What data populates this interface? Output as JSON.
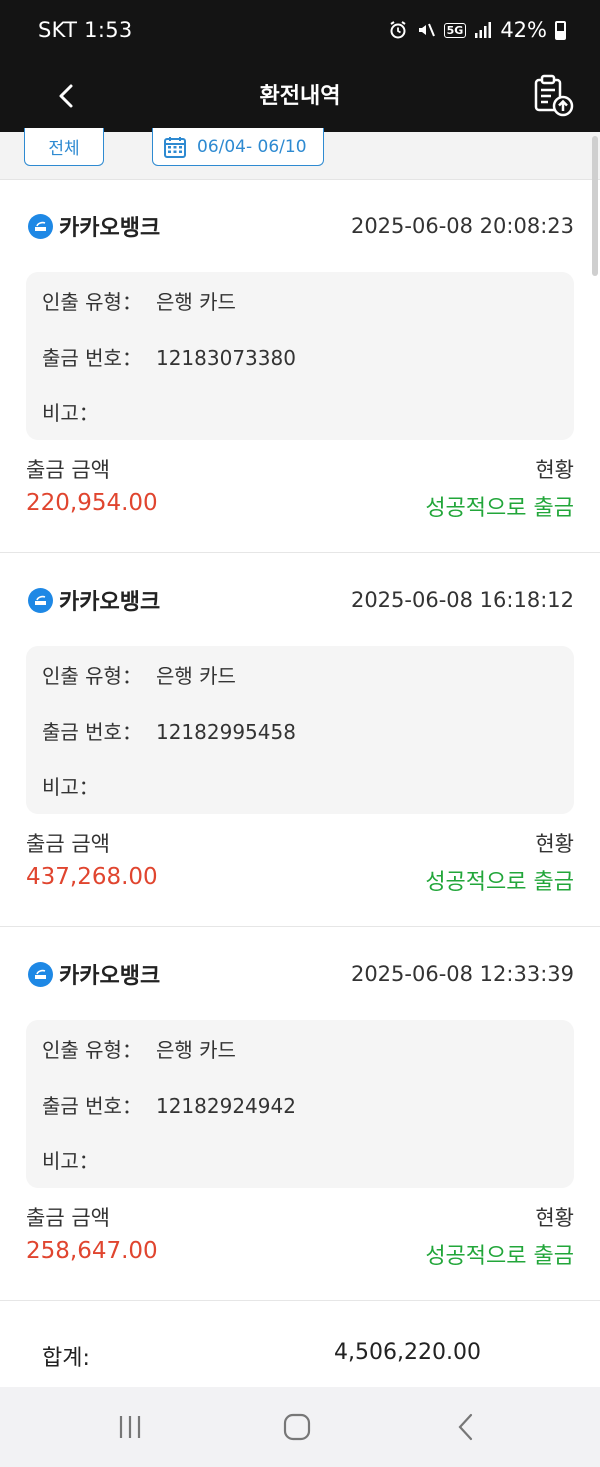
{
  "status_bar": {
    "carrier_time": "SKT 1:53",
    "network": "5G",
    "battery": "42%"
  },
  "app_bar": {
    "title": "환전내역"
  },
  "filter": {
    "all_label": "전체",
    "date_range": "06/04- 06/10"
  },
  "labels": {
    "withdraw_type": "인출 유형：",
    "withdraw_no": "출금 번호：",
    "note": "비고：",
    "amount": "출금 금액",
    "status": "현황"
  },
  "records": [
    {
      "bank": "카카오뱅크",
      "datetime": "2025-06-08 20:08:23",
      "type": "은행 카드",
      "number": "12183073380",
      "note": "",
      "amount": "220,954.00",
      "status": "성공적으로 출금"
    },
    {
      "bank": "카카오뱅크",
      "datetime": "2025-06-08 16:18:12",
      "type": "은행 카드",
      "number": "12182995458",
      "note": "",
      "amount": "437,268.00",
      "status": "성공적으로 출금"
    },
    {
      "bank": "카카오뱅크",
      "datetime": "2025-06-08 12:33:39",
      "type": "은행 카드",
      "number": "12182924942",
      "note": "",
      "amount": "258,647.00",
      "status": "성공적으로 출금"
    }
  ],
  "total": {
    "label": "합계:",
    "value": "4,506,220.00"
  },
  "colors": {
    "amount": "#e0452f",
    "status_success": "#22a63a",
    "accent": "#2e8ad1",
    "header_bg": "#141414"
  },
  "icons": {
    "back": "chevron-left-icon",
    "export": "clipboard-upload-icon",
    "calendar": "calendar-icon",
    "bank_logo": "kakaobank-logo-icon"
  }
}
